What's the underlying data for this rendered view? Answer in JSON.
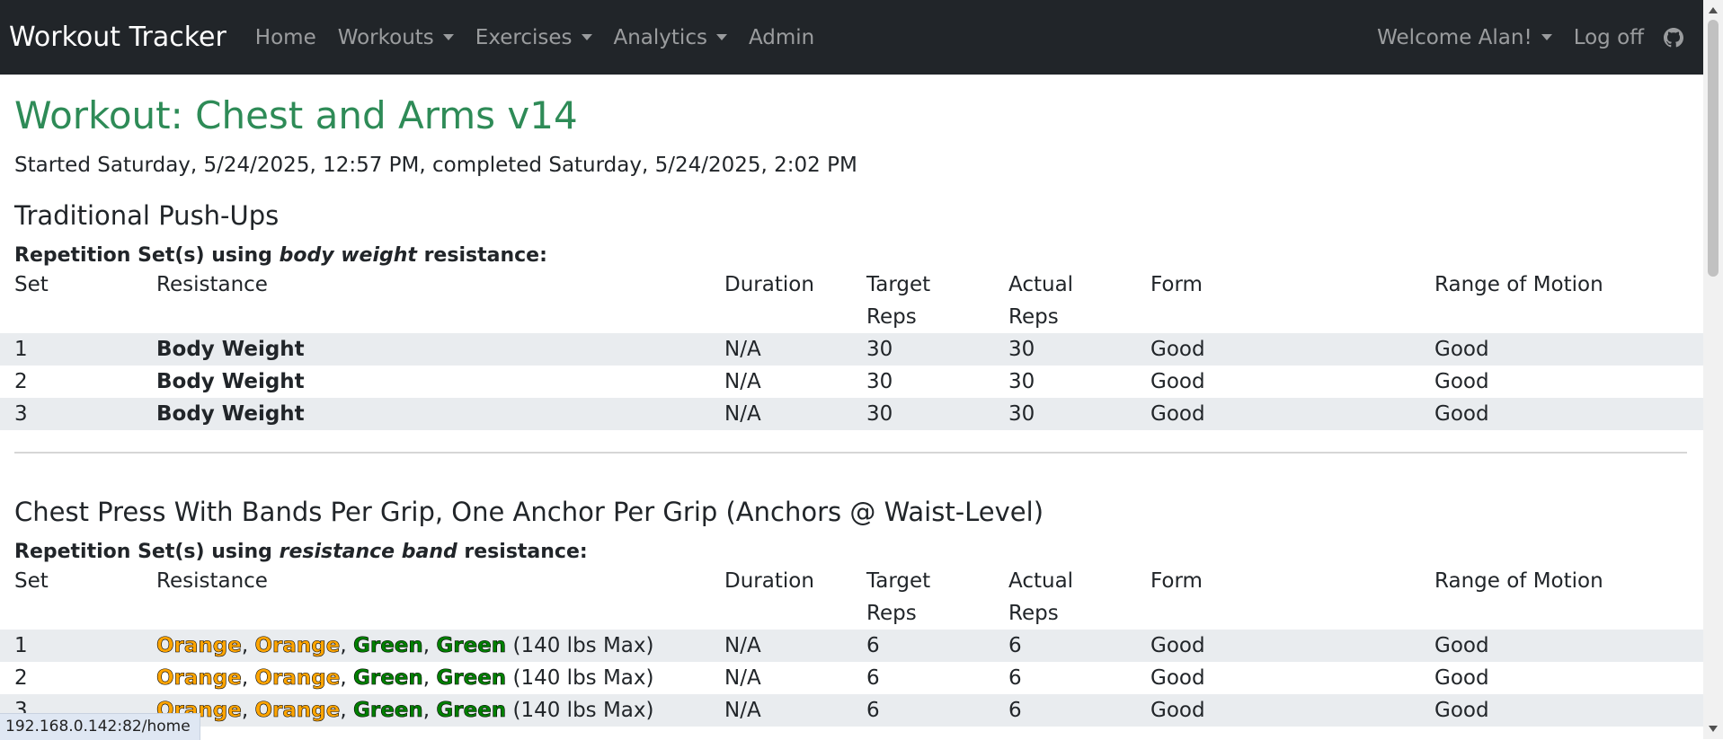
{
  "nav": {
    "brand": "Workout Tracker",
    "home": "Home",
    "workouts": "Workouts",
    "exercises": "Exercises",
    "analytics": "Analytics",
    "admin": "Admin",
    "welcome": "Welcome Alan!",
    "logoff": "Log off",
    "github_icon": "github-icon"
  },
  "page": {
    "title": "Workout: Chest and Arms v14",
    "subtitle": "Started Saturday, 5/24/2025, 12:57 PM, completed Saturday, 5/24/2025, 2:02 PM"
  },
  "columns": {
    "set": "Set",
    "resistance": "Resistance",
    "duration": "Duration",
    "target1": "Target",
    "target2": "Reps",
    "actual1": "Actual",
    "actual2": "Reps",
    "form": "Form",
    "rom": "Range of Motion"
  },
  "exercises": [
    {
      "title": "Traditional Push-Ups",
      "set_type_prefix": "Repetition Set(s) using ",
      "set_type_kind": "body weight",
      "set_type_suffix": " resistance:",
      "rows": [
        {
          "set": "1",
          "resistance": "Body Weight",
          "duration": "N/A",
          "target": "30",
          "actual": "30",
          "form": "Good",
          "rom": "Good"
        },
        {
          "set": "2",
          "resistance": "Body Weight",
          "duration": "N/A",
          "target": "30",
          "actual": "30",
          "form": "Good",
          "rom": "Good"
        },
        {
          "set": "3",
          "resistance": "Body Weight",
          "duration": "N/A",
          "target": "30",
          "actual": "30",
          "form": "Good",
          "rom": "Good"
        }
      ]
    },
    {
      "title": "Chest Press With Bands Per Grip, One Anchor Per Grip (Anchors @ Waist-Level)",
      "set_type_prefix": "Repetition Set(s) using ",
      "set_type_kind": "resistance band",
      "set_type_suffix": " resistance:",
      "rows": [
        {
          "set": "1",
          "bands": [
            "Orange",
            "Orange",
            "Green",
            "Green"
          ],
          "max": "(140 lbs Max)",
          "duration": "N/A",
          "target": "6",
          "actual": "6",
          "form": "Good",
          "rom": "Good"
        },
        {
          "set": "2",
          "bands": [
            "Orange",
            "Orange",
            "Green",
            "Green"
          ],
          "max": "(140 lbs Max)",
          "duration": "N/A",
          "target": "6",
          "actual": "6",
          "form": "Good",
          "rom": "Good"
        },
        {
          "set": "3",
          "bands": [
            "Orange",
            "Orange",
            "Green",
            "Green"
          ],
          "max": "(140 lbs Max)",
          "duration": "N/A",
          "target": "6",
          "actual": "6",
          "form": "Good",
          "rom": "Good"
        }
      ]
    }
  ],
  "colors": {
    "navbar": "#212529",
    "title": "#2e8b57",
    "stripe": "#e9ecef",
    "orange_band": "#ffa500",
    "green_band": "#008000"
  },
  "status_url": "192.168.0.142:82/home"
}
